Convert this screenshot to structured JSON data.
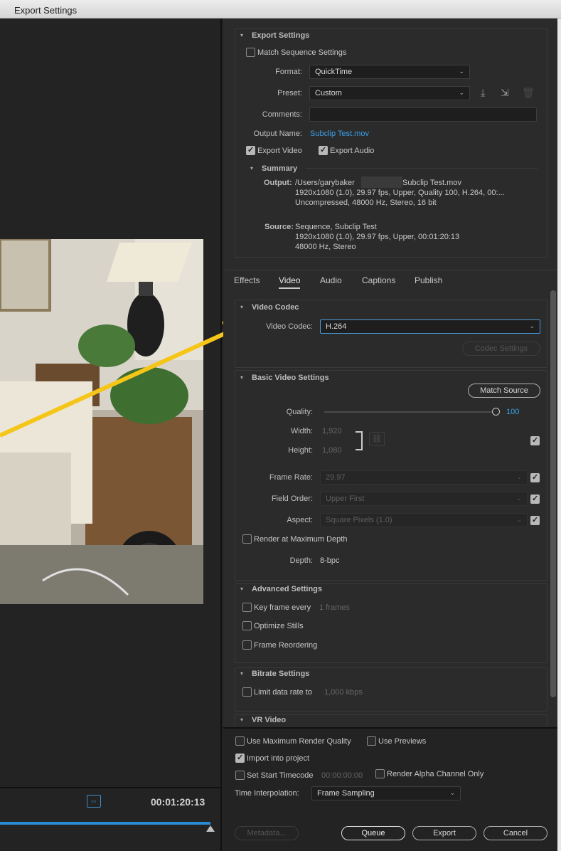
{
  "window": {
    "title": "Export Settings"
  },
  "preview": {
    "timecode": "00:01:20:13",
    "fit_icon": "fit-frame-icon"
  },
  "export_settings": {
    "section_title": "Export Settings",
    "match_sequence_label": "Match Sequence Settings",
    "format_label": "Format:",
    "format_value": "QuickTime",
    "preset_label": "Preset:",
    "preset_value": "Custom",
    "comments_label": "Comments:",
    "comments_value": "",
    "output_name_label": "Output Name:",
    "output_name_value": "Subclip Test.mov",
    "export_video_label": "Export Video",
    "export_audio_label": "Export Audio",
    "summary_title": "Summary",
    "output_label": "Output:",
    "output_line1": "/Users/garybaker",
    "output_line1b": "Subclip Test.mov",
    "output_line2": "1920x1080 (1.0), 29.97 fps, Upper, Quality 100, H.264, 00:...",
    "output_line3": "Uncompressed, 48000 Hz, Stereo, 16 bit",
    "source_label": "Source:",
    "source_line1": "Sequence, Subclip Test",
    "source_line2": "1920x1080 (1.0), 29.97 fps, Upper, 00:01:20:13",
    "source_line3": "48000 Hz, Stereo"
  },
  "tabs": [
    "Effects",
    "Video",
    "Audio",
    "Captions",
    "Publish"
  ],
  "video_codec": {
    "section_title": "Video Codec",
    "codec_label": "Video Codec:",
    "codec_value": "H.264",
    "codec_settings_button": "Codec Settings"
  },
  "basic_video": {
    "section_title": "Basic Video Settings",
    "match_source_button": "Match Source",
    "quality_label": "Quality:",
    "quality_value": "100",
    "quality_fraction": 1.0,
    "width_label": "Width:",
    "width_value": "1,920",
    "height_label": "Height:",
    "height_value": "1,080",
    "frame_rate_label": "Frame Rate:",
    "frame_rate_value": "29.97",
    "field_order_label": "Field Order:",
    "field_order_value": "Upper First",
    "aspect_label": "Aspect:",
    "aspect_value": "Square Pixels (1.0)",
    "render_max_depth_label": "Render at Maximum Depth",
    "depth_label": "Depth:",
    "depth_value": "8-bpc"
  },
  "advanced": {
    "section_title": "Advanced Settings",
    "keyframe_label": "Key frame every",
    "keyframe_value": "1 frames",
    "optimize_stills_label": "Optimize Stills",
    "frame_reordering_label": "Frame Reordering"
  },
  "bitrate": {
    "section_title": "Bitrate Settings",
    "limit_label": "Limit data rate to",
    "limit_value": "1,000 kbps"
  },
  "vr": {
    "section_title": "VR Video"
  },
  "bottom": {
    "max_render_quality_label": "Use Maximum Render Quality",
    "use_previews_label": "Use Previews",
    "import_label": "Import into project",
    "start_timecode_label": "Set Start Timecode",
    "start_timecode_value": "00:00:00:00",
    "alpha_label": "Render Alpha Channel Only",
    "time_interp_label": "Time Interpolation:",
    "time_interp_value": "Frame Sampling",
    "metadata_button": "Metadata...",
    "queue_button": "Queue",
    "export_button": "Export",
    "cancel_button": "Cancel"
  },
  "colors": {
    "accent_blue": "#3aa0e8",
    "arrow_yellow": "#f5c518",
    "panel": "#2b2b2b"
  }
}
